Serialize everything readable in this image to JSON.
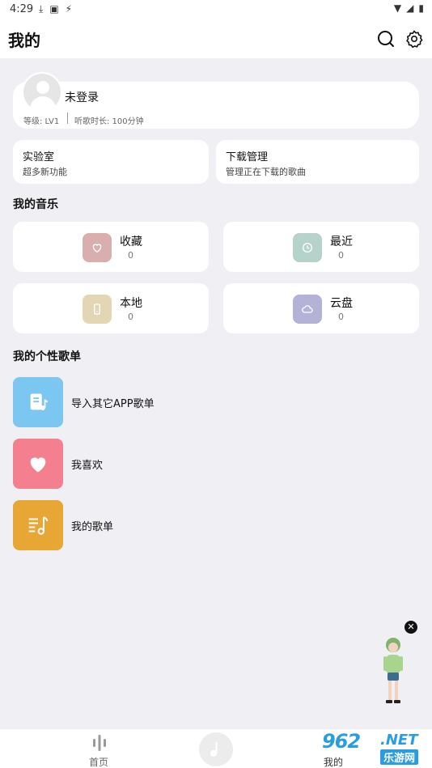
{
  "status_bar": {
    "time": "4:29"
  },
  "header": {
    "title": "我的"
  },
  "profile": {
    "login_status": "未登录",
    "level": "等级: LV1",
    "listen_time": "听歌时长: 100分钟"
  },
  "quick_cards": [
    {
      "title": "实验室",
      "subtitle": "超多新功能"
    },
    {
      "title": "下载管理",
      "subtitle": "管理正在下载的歌曲"
    }
  ],
  "my_music": {
    "title": "我的音乐",
    "items": [
      {
        "label": "收藏",
        "count": "0",
        "color": "#d9aeae",
        "icon": "heart-icon"
      },
      {
        "label": "最近",
        "count": "0",
        "color": "#b5d3cb",
        "icon": "clock-icon"
      },
      {
        "label": "本地",
        "count": "0",
        "color": "#e3d6b5",
        "icon": "phone-icon"
      },
      {
        "label": "云盘",
        "count": "0",
        "color": "#b4b2d6",
        "icon": "cloud-icon"
      }
    ]
  },
  "playlists": {
    "title": "我的个性歌单",
    "items": [
      {
        "label": "导入其它APP歌单",
        "color": "#7cc7f2",
        "icon": "music-file-icon"
      },
      {
        "label": "我喜欢",
        "color": "#f47f8f",
        "icon": "heart-icon"
      },
      {
        "label": "我的歌单",
        "color": "#e8a635",
        "icon": "playlist-icon"
      }
    ]
  },
  "bottom_nav": {
    "home_label": "首页",
    "mine_label": "我的"
  },
  "watermark": {
    "number": "962",
    "suffix": ".NET",
    "site_name": "乐游网"
  }
}
